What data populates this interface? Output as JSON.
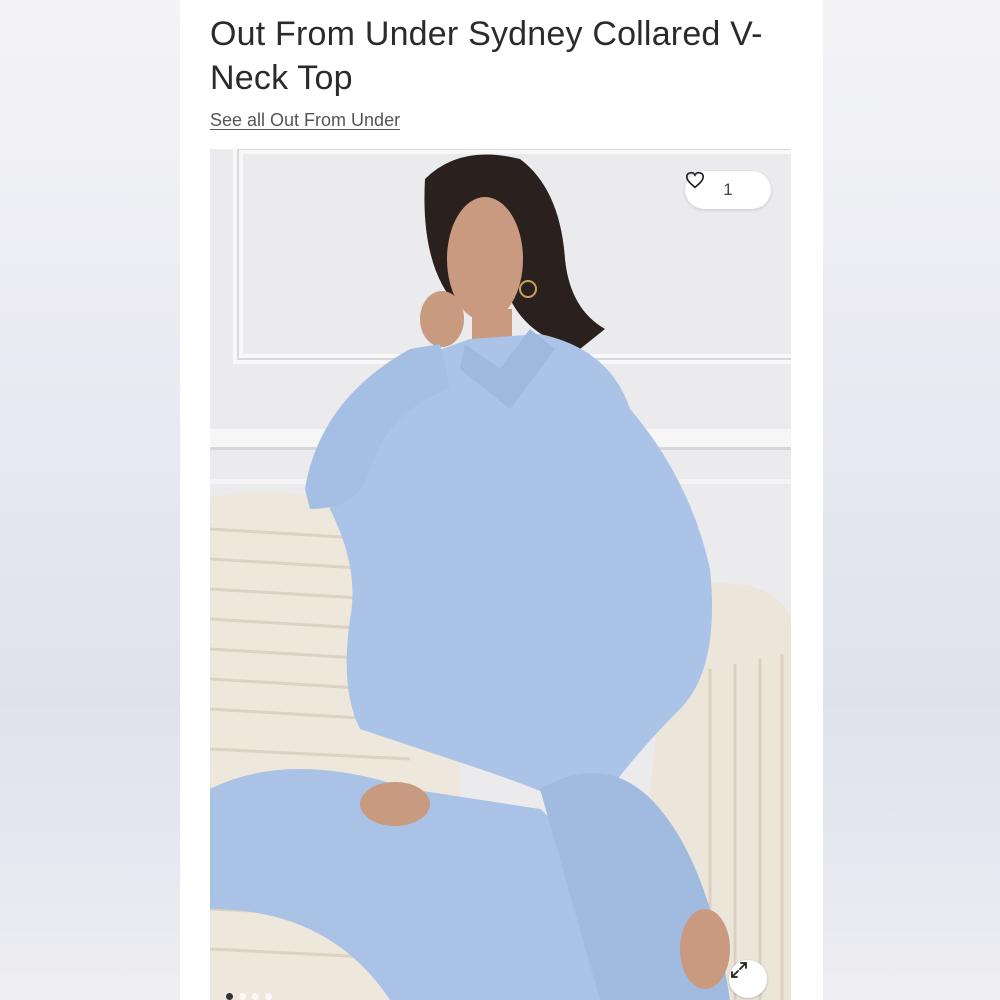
{
  "product": {
    "title": "Out From Under Sydney Collared V-Neck Top",
    "brand_link": "See all Out From Under"
  },
  "gallery": {
    "like_count": "1",
    "heart_icon": "heart-outline-icon",
    "expand_icon": "expand-arrows-icon",
    "dot_count": 4,
    "active_dot": 0
  },
  "colors": {
    "garment": "#aac3e6",
    "sofa": "#eee7dc",
    "wall": "#ebeaec",
    "text": "#2b2b2b"
  }
}
